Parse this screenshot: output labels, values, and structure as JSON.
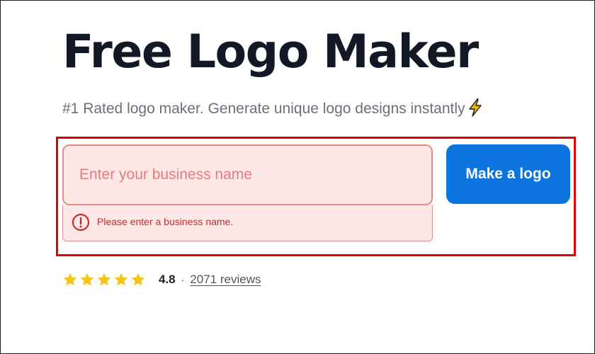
{
  "hero": {
    "title": "Free Logo Maker",
    "subtitle": "#1 Rated logo maker. Generate unique logo designs instantly",
    "subtitle_icon": "lightning-bolt-icon"
  },
  "form": {
    "business_name": {
      "placeholder": "Enter your business name",
      "value": ""
    },
    "error_message": "Please enter a business name.",
    "error_icon": "alert-circle-icon",
    "submit_label": "Make a logo"
  },
  "rating": {
    "stars": 5,
    "value": "4.8",
    "separator": "·",
    "reviews_label": "2071 reviews"
  },
  "colors": {
    "primary_button": "#0b74df",
    "error_red": "#cc2a2a",
    "error_bg": "#fde7e7",
    "highlight_border": "#e00000",
    "star_gold": "#f5c518",
    "title_text": "#121826"
  }
}
